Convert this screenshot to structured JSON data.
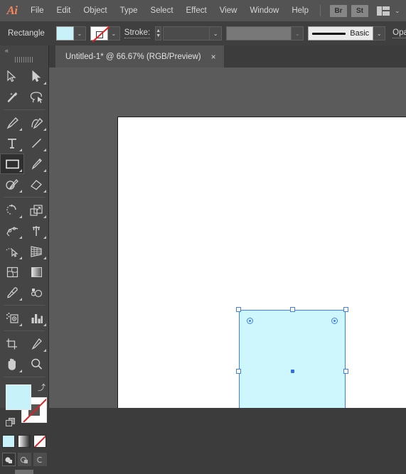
{
  "app": {
    "logo": "Ai",
    "name": "Adobe Illustrator"
  },
  "menubar": {
    "items": [
      {
        "label": "File"
      },
      {
        "label": "Edit"
      },
      {
        "label": "Object"
      },
      {
        "label": "Type"
      },
      {
        "label": "Select"
      },
      {
        "label": "Effect"
      },
      {
        "label": "View"
      },
      {
        "label": "Window"
      },
      {
        "label": "Help"
      }
    ],
    "bridge_button": "Br",
    "stock_button": "St",
    "workspace_icon": "workspace-switcher-icon",
    "workspace_chevron": "⌄"
  },
  "controlbar": {
    "grip_icon": "drag-grip-icon",
    "selection_label": "Rectangle",
    "fill": {
      "name": "fill-swatch",
      "color": "#c7f2fa",
      "chevron": "⌄"
    },
    "stroke_swatch": {
      "name": "stroke-swatch",
      "color": "none",
      "none_color": "#e02020",
      "chevron": "⌄"
    },
    "stroke_label": "Stroke:",
    "stroke_weight_value": "",
    "stroke_stepper_up": "▲",
    "stroke_stepper_down": "▼",
    "stroke_profile_value": "",
    "stroke_profile_chevron": "⌄",
    "brush_definition": "Basic",
    "brush_chevron": "⌄",
    "opacity_label": "Opacity"
  },
  "tabbar": {
    "tab_title": "Untitled-1* @ 66.67% (RGB/Preview)",
    "close_icon": "×"
  },
  "toolbar": {
    "collapse_icon": "«",
    "grip_icon": "toolbar-drag-grip",
    "groups": [
      {
        "tools": [
          {
            "name": "selection-tool",
            "icon": "arrow-cursor-icon",
            "has_flyout": false,
            "active": false
          },
          {
            "name": "direct-selection-tool",
            "icon": "white-arrow-cursor-icon",
            "has_flyout": true,
            "active": false
          },
          {
            "name": "magic-wand-tool",
            "icon": "magic-wand-icon",
            "has_flyout": false,
            "active": false
          },
          {
            "name": "lasso-tool",
            "icon": "lasso-icon",
            "has_flyout": false,
            "active": false
          }
        ]
      },
      {
        "tools": [
          {
            "name": "pen-tool",
            "icon": "pen-nib-icon",
            "has_flyout": true,
            "active": false
          },
          {
            "name": "curvature-tool",
            "icon": "curvature-pen-icon",
            "has_flyout": true,
            "active": false
          },
          {
            "name": "type-tool",
            "icon": "type-t-icon",
            "has_flyout": true,
            "active": false
          },
          {
            "name": "line-segment-tool",
            "icon": "line-diagonal-icon",
            "has_flyout": true,
            "active": false
          },
          {
            "name": "rectangle-tool",
            "icon": "rectangle-icon",
            "has_flyout": true,
            "active": true
          },
          {
            "name": "paintbrush-tool",
            "icon": "paintbrush-icon",
            "has_flyout": true,
            "active": false
          },
          {
            "name": "shaper-pencil-tool",
            "icon": "shaper-pencil-icon",
            "has_flyout": true,
            "active": false
          },
          {
            "name": "eraser-tool",
            "icon": "eraser-icon",
            "has_flyout": true,
            "active": false
          }
        ]
      },
      {
        "tools": [
          {
            "name": "rotate-tool",
            "icon": "rotate-arrow-icon",
            "has_flyout": true,
            "active": false
          },
          {
            "name": "scale-tool",
            "icon": "scale-squares-icon",
            "has_flyout": true,
            "active": false
          },
          {
            "name": "width-tool",
            "icon": "width-warp-icon",
            "has_flyout": true,
            "active": false
          },
          {
            "name": "free-transform-tool",
            "icon": "pushpin-icon",
            "has_flyout": true,
            "active": false
          },
          {
            "name": "shape-builder-tool",
            "icon": "shape-builder-icon",
            "has_flyout": true,
            "active": false
          },
          {
            "name": "perspective-grid-tool",
            "icon": "perspective-grid-icon",
            "has_flyout": true,
            "active": false
          },
          {
            "name": "mesh-tool",
            "icon": "mesh-net-icon",
            "has_flyout": false,
            "active": false
          },
          {
            "name": "gradient-tool",
            "icon": "gradient-square-icon",
            "has_flyout": false,
            "active": false
          },
          {
            "name": "eyedropper-tool",
            "icon": "eyedropper-icon",
            "has_flyout": true,
            "active": false
          },
          {
            "name": "blend-tool",
            "icon": "blend-circles-icon",
            "has_flyout": false,
            "active": false
          }
        ]
      },
      {
        "tools": [
          {
            "name": "symbol-sprayer-tool",
            "icon": "symbol-sprayer-icon",
            "has_flyout": true,
            "active": false
          },
          {
            "name": "column-graph-tool",
            "icon": "bar-chart-icon",
            "has_flyout": true,
            "active": false
          }
        ]
      },
      {
        "tools": [
          {
            "name": "artboard-tool",
            "icon": "artboard-crop-icon",
            "has_flyout": false,
            "active": false
          },
          {
            "name": "slice-tool",
            "icon": "slice-knife-icon",
            "has_flyout": true,
            "active": false
          },
          {
            "name": "hand-tool",
            "icon": "hand-icon",
            "has_flyout": true,
            "active": false
          },
          {
            "name": "zoom-tool",
            "icon": "magnifier-icon",
            "has_flyout": false,
            "active": false
          }
        ]
      }
    ],
    "fill_stroke": {
      "fill_color": "#c7f2fa",
      "stroke_color": "none",
      "swap_icon": "⤴",
      "default_icon": "default-fill-stroke-icon"
    },
    "color_modes": [
      {
        "name": "color-mode-button",
        "label": "Color"
      },
      {
        "name": "gradient-mode-button",
        "label": "Gradient"
      },
      {
        "name": "none-mode-button",
        "label": "None"
      }
    ],
    "draw_modes": [
      {
        "name": "draw-normal-button",
        "label": "Draw Normal",
        "selected": true
      },
      {
        "name": "draw-behind-button",
        "label": "Draw Behind",
        "selected": false
      },
      {
        "name": "draw-inside-button",
        "label": "Draw Inside",
        "selected": false
      }
    ],
    "screen_mode": {
      "name": "change-screen-mode-button",
      "label": "Change Screen Mode"
    }
  },
  "canvas": {
    "background_color": "#5b5b5b",
    "artboard_color": "#ffffff",
    "selection": {
      "shape_type": "Rectangle",
      "fill_color": "#cdf6fd",
      "selection_color": "#3f7ff2",
      "handles": [
        "top-left",
        "top-center",
        "top-right",
        "middle-left",
        "middle-right",
        "bottom-left",
        "bottom-center",
        "bottom-right"
      ],
      "corner_widgets": [
        "top-left",
        "top-right",
        "bottom-left",
        "bottom-right"
      ],
      "center_point": "center-anchor-point"
    }
  }
}
